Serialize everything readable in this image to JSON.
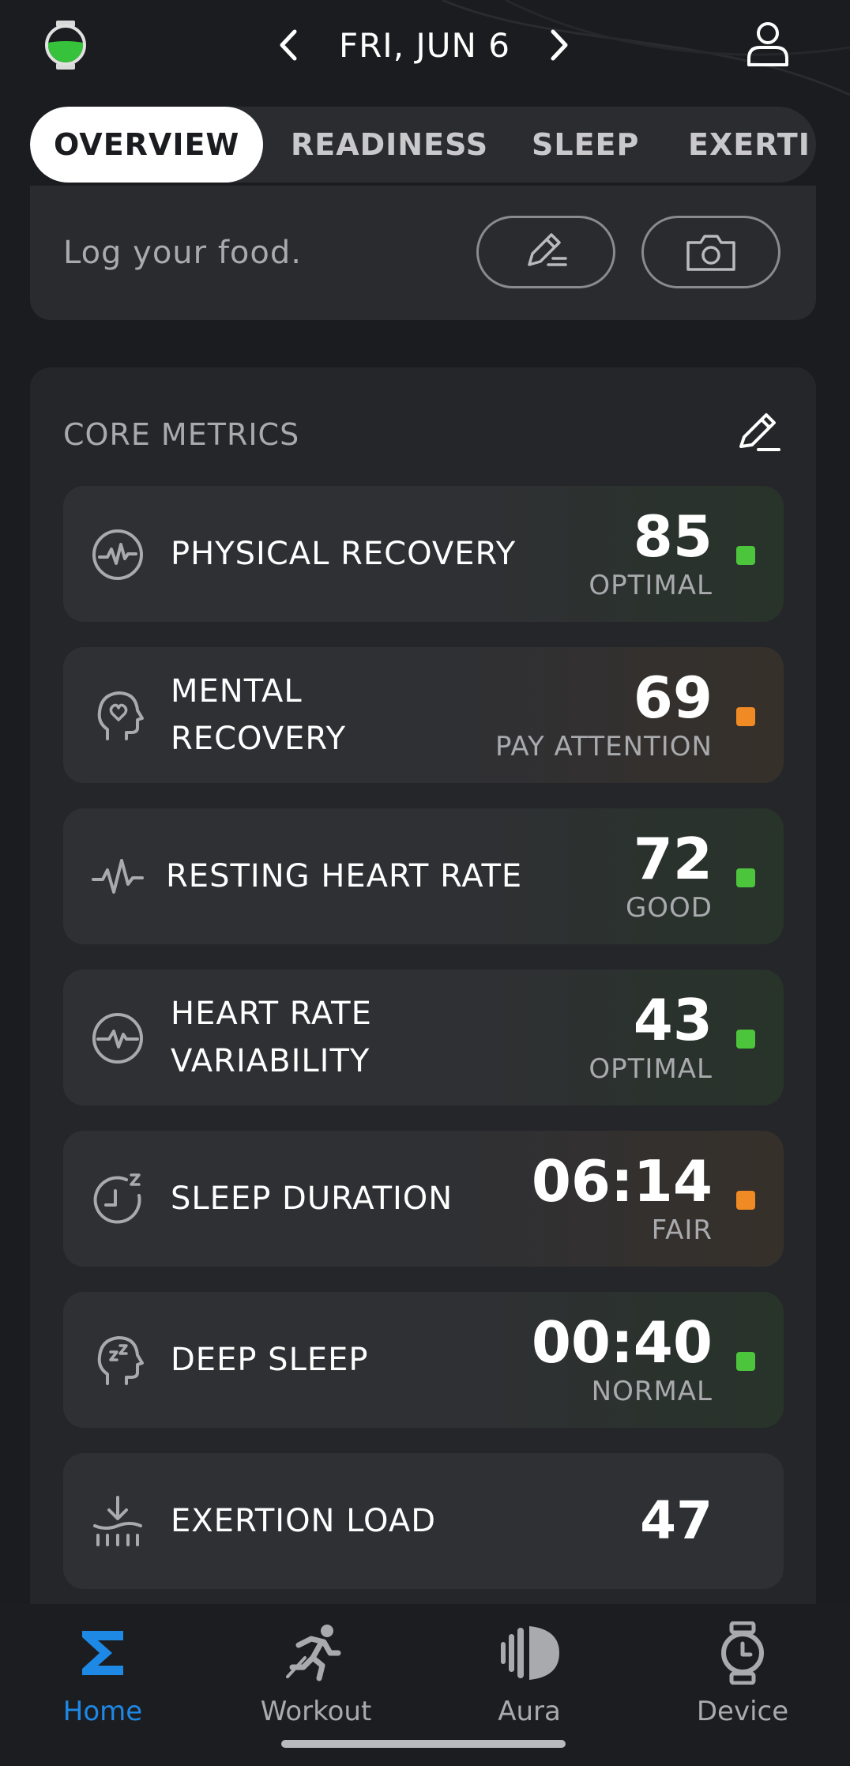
{
  "header": {
    "date": "FRI, JUN 6"
  },
  "tabs": [
    {
      "label": "OVERVIEW",
      "active": true
    },
    {
      "label": "READINESS",
      "active": false
    },
    {
      "label": "SLEEP",
      "active": false
    },
    {
      "label": "EXERTI",
      "active": false
    }
  ],
  "food": {
    "prompt": "Log your food."
  },
  "core_metrics": {
    "title": "CORE METRICS",
    "items": [
      {
        "label_lines": [
          "PHYSICAL RECOVERY"
        ],
        "value": "85",
        "status": "OPTIMAL",
        "indicator": "green",
        "icon": "pulse-circle-icon"
      },
      {
        "label_lines": [
          "MENTAL",
          "RECOVERY"
        ],
        "value": "69",
        "status": "PAY ATTENTION",
        "indicator": "orange",
        "icon": "head-heart-icon"
      },
      {
        "label_lines": [
          "RESTING HEART RATE"
        ],
        "value": "72",
        "status": "GOOD",
        "indicator": "green",
        "icon": "heartbeat-icon"
      },
      {
        "label_lines": [
          "HEART RATE",
          "VARIABILITY"
        ],
        "value": "43",
        "status": "OPTIMAL",
        "indicator": "green",
        "icon": "hrv-circle-icon"
      },
      {
        "label_lines": [
          "SLEEP DURATION"
        ],
        "value": "06:14",
        "status": "FAIR",
        "indicator": "orange",
        "icon": "sleep-clock-icon"
      },
      {
        "label_lines": [
          "DEEP SLEEP"
        ],
        "value": "00:40",
        "status": "NORMAL",
        "indicator": "green",
        "icon": "head-sleep-icon"
      },
      {
        "label_lines": [
          "EXERTION LOAD"
        ],
        "value": "47",
        "status": "",
        "indicator": "none",
        "icon": "exertion-load-icon"
      }
    ]
  },
  "colors": {
    "green": "#4cc43c",
    "orange": "#f08a24",
    "accent_blue": "#1e88e5"
  },
  "nav": [
    {
      "label": "Home",
      "active": true,
      "icon": "sigma-icon"
    },
    {
      "label": "Workout",
      "active": false,
      "icon": "runner-icon"
    },
    {
      "label": "Aura",
      "active": false,
      "icon": "aura-icon"
    },
    {
      "label": "Device",
      "active": false,
      "icon": "watch-icon"
    }
  ]
}
